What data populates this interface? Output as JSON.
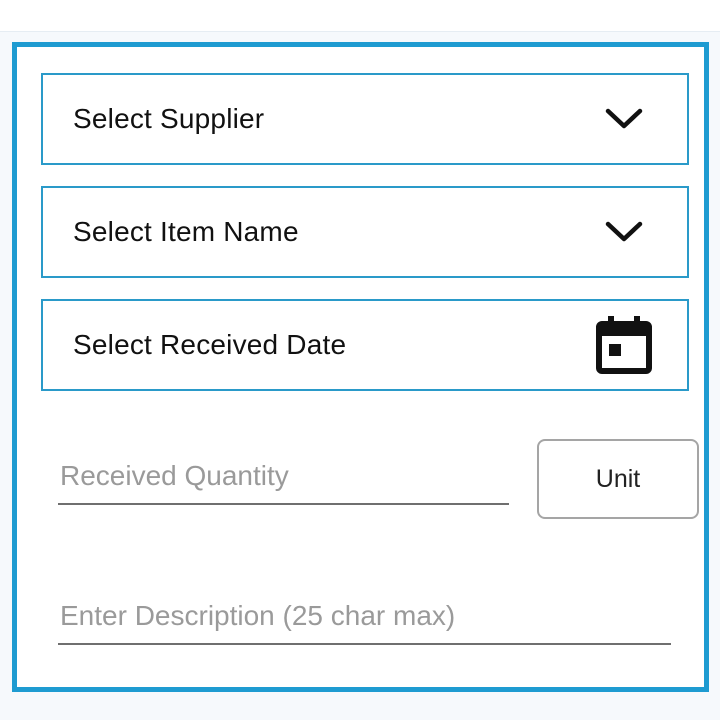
{
  "form": {
    "supplier_select": {
      "label": "Select Supplier",
      "icon": "chevron-down-icon"
    },
    "item_select": {
      "label": "Select Item Name",
      "icon": "chevron-down-icon"
    },
    "date_select": {
      "label": "Select Received Date",
      "icon": "calendar-icon"
    },
    "quantity_input": {
      "placeholder": "Received Quantity",
      "value": ""
    },
    "unit_button": {
      "label": "Unit"
    },
    "description_input": {
      "placeholder": "Enter Description (25 char max)",
      "value": ""
    }
  },
  "colors": {
    "panel_border": "#1e9bd1",
    "field_border": "#2a9ac9",
    "placeholder": "#9a9a9a",
    "underline": "#6f6f6f"
  }
}
